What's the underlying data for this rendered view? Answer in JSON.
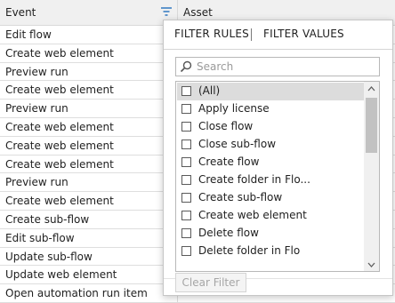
{
  "grid": {
    "columns": {
      "event": "Event",
      "asset": "Asset"
    },
    "rows": [
      "Edit flow",
      "Create web element",
      "Preview run",
      "Create web element",
      "Preview run",
      "Create web element",
      "Create web element",
      "Create web element",
      "Preview run",
      "Create web element",
      "Create sub-flow",
      "Edit sub-flow",
      "Update sub-flow",
      "Update web element",
      "Open automation run item"
    ]
  },
  "filter_popup": {
    "tabs": {
      "rules": "FILTER RULES",
      "values": "FILTER VALUES"
    },
    "search": {
      "placeholder": "Search",
      "value": ""
    },
    "options": [
      {
        "label": "(All)",
        "checked": false,
        "highlighted": true
      },
      {
        "label": "Apply license",
        "checked": false
      },
      {
        "label": "Close flow",
        "checked": false
      },
      {
        "label": "Close sub-flow",
        "checked": false
      },
      {
        "label": "Create flow",
        "checked": false
      },
      {
        "label": "Create folder in Flo...",
        "checked": false
      },
      {
        "label": "Create sub-flow",
        "checked": false
      },
      {
        "label": "Create web element",
        "checked": false
      },
      {
        "label": "Delete flow",
        "checked": false
      },
      {
        "label": "Delete folder in Flo",
        "checked": false
      }
    ],
    "scroll_position": 0.0,
    "clear_button": {
      "label": "Clear Filter",
      "enabled": false
    }
  },
  "colors": {
    "header_bg": "#f0f0f0",
    "filter_icon": "#3c7fc4",
    "selected_item": "#dcdcdc",
    "scroll_thumb": "#c2c2c2"
  },
  "icons": {
    "filter": "filter-icon",
    "search": "search-icon",
    "scroll_up": "chevron-up-icon",
    "scroll_down": "chevron-down-icon"
  }
}
